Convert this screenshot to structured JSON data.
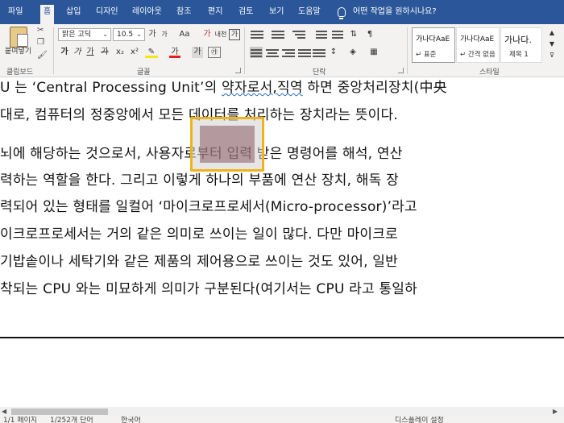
{
  "tabs": [
    "파일",
    "홈",
    "삽입",
    "디자인",
    "레이아웃",
    "참조",
    "편지",
    "검토",
    "보기",
    "도움말"
  ],
  "tell_me": "어떤 작업을 원하시나요?",
  "ribbon": {
    "paste_label": "붙여넣기",
    "clipboard_label": "클립보드",
    "font_name": "맑은 고딕",
    "font_size": "10.5",
    "grow_font": "가",
    "shrink_font": "가",
    "change_case": "Aa",
    "clear_format": "가",
    "phonetic": "내천",
    "char_border": "가",
    "bold": "가",
    "italic": "가",
    "underline": "가",
    "strike": "가",
    "subscript": "x₂",
    "superscript": "x²",
    "font_color": "가",
    "char_shading": "가",
    "font_label": "글꼴",
    "paragraph_label": "단락",
    "styles": [
      {
        "sample": "가나다AaE",
        "name": "↵ 표준"
      },
      {
        "sample": "가나다AaE",
        "name": "↵ 간격 없음"
      },
      {
        "sample": "가나다.",
        "name": "제목 1"
      }
    ],
    "styles_label": "스타일"
  },
  "document": {
    "lines": [
      {
        "pre": "U 는 ‘Central Processing Unit’의 ",
        "squig": "약자로서,직역",
        "post": " 하면 중앙처리장치(中央"
      },
      {
        "pre": "대로, 컴퓨터의 정중앙에서 모든 데이터를 처리하는 장치라는 뜻이다.",
        "squig": "",
        "post": ""
      },
      {
        "pre": "뇌에 해당하는 것으로서, 사용자로부터 입력 받은 명령어를 해석, 연산",
        "squig": "",
        "post": ""
      },
      {
        "pre": "력하는 역할을 한다. 그리고 이렇게 하나의 부품에 연산 장치, 해독 장",
        "squig": "",
        "post": ""
      },
      {
        "pre": "력되어 있는 형태를 일컬어 ‘마이크로프로세서(Micro-processor)’라고 ",
        "squig": "",
        "post": ""
      },
      {
        "pre": "이크로프로세서는 거의 같은 의미로 쓰이는 일이 많다. 다만 마이크로",
        "squig": "",
        "post": ""
      },
      {
        "pre": "기밥솥이나 세탁기와 같은 제품의 제어용으로 쓰이는 것도 있어, 일반",
        "squig": "",
        "post": ""
      },
      {
        "pre": "착되는 CPU 와는 미묘하게 의미가 구분된다(여기서는 CPU 라고 통일하",
        "squig": "",
        "post": ""
      }
    ]
  },
  "status": {
    "page": "1/1 페이지",
    "words": "1/252개 단어",
    "language": "한국어",
    "display": "디스플레이 설정"
  }
}
